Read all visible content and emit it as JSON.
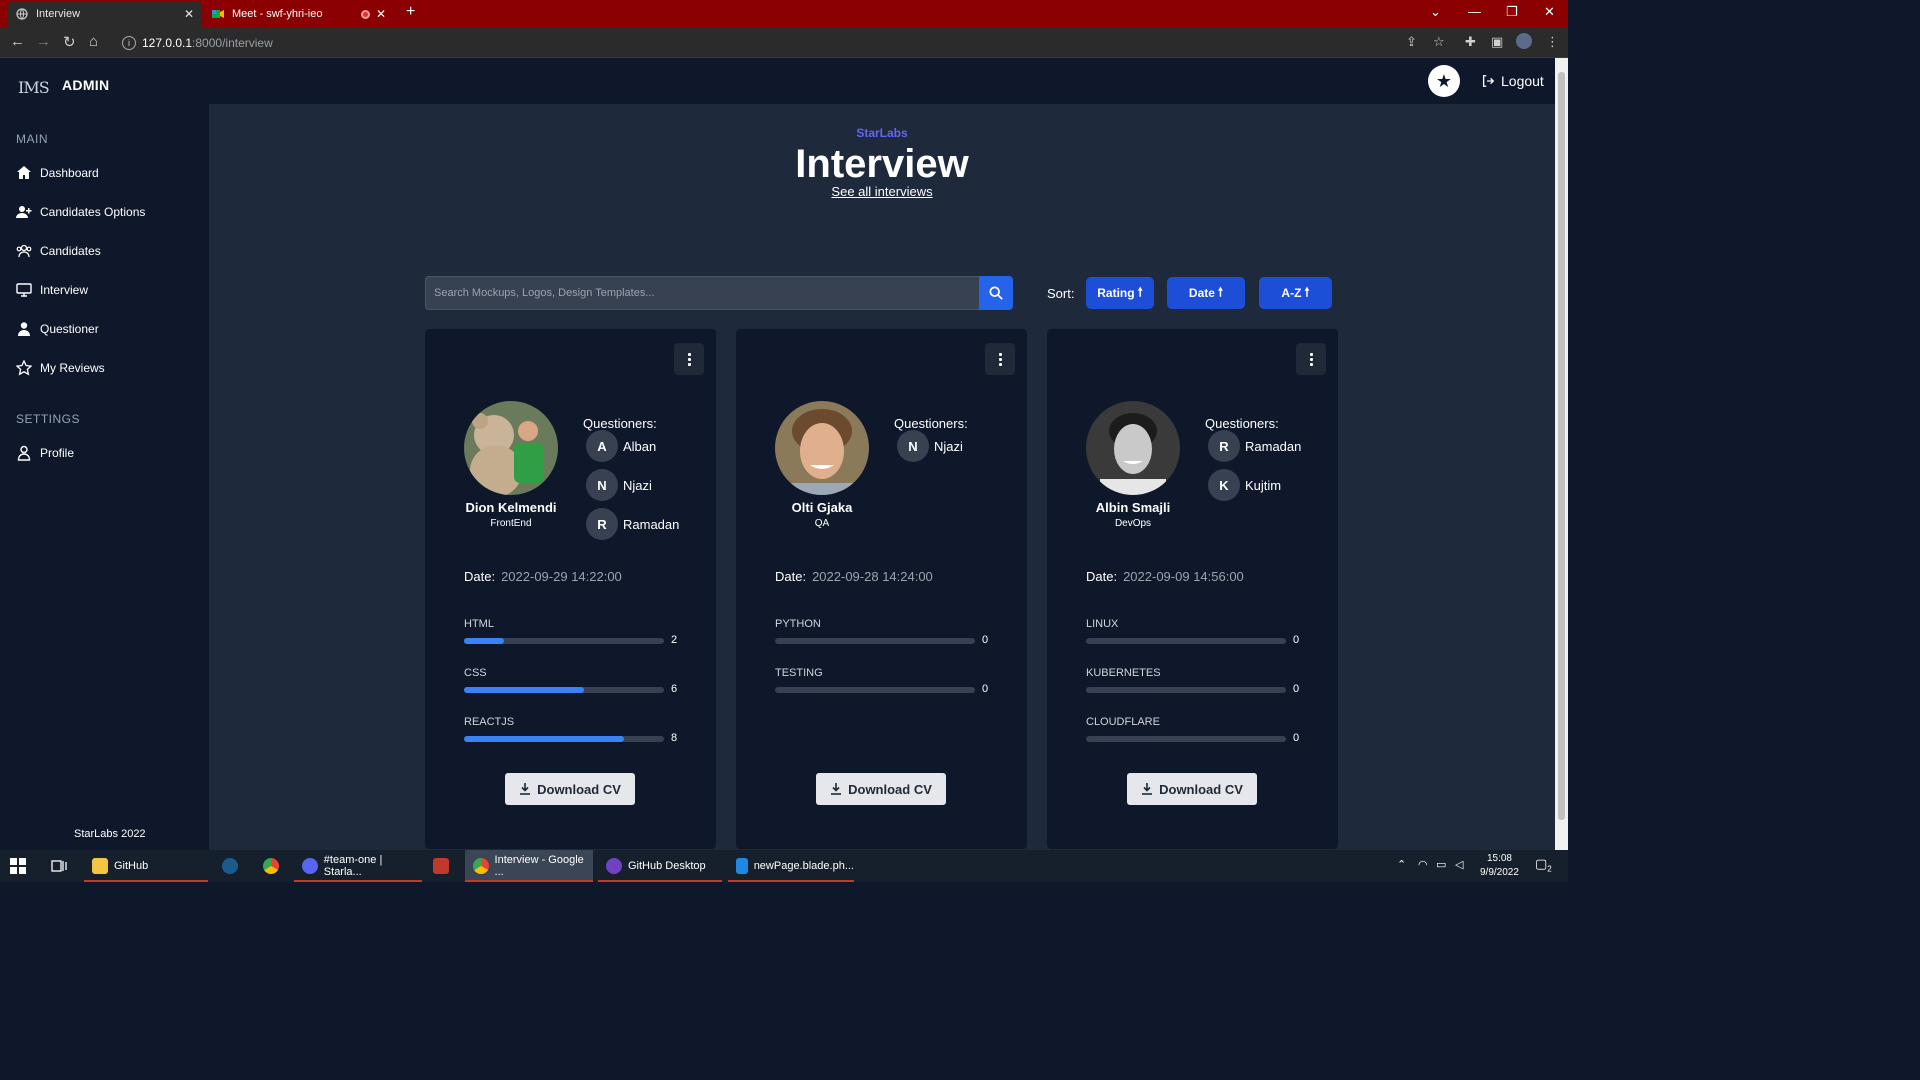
{
  "browser": {
    "tabs": [
      {
        "title": "Interview",
        "active": true
      },
      {
        "title": "Meet - swf-yhri-ieo",
        "active": false,
        "recording": true
      }
    ],
    "url_host": "127.0.0.1",
    "url_path": ":8000/interview"
  },
  "app": {
    "logo": "IMS",
    "role": "ADMIN",
    "logout_label": "Logout"
  },
  "sidebar": {
    "main_section": "MAIN",
    "settings_section": "SETTINGS",
    "items": [
      {
        "label": "Dashboard",
        "icon": "home-icon"
      },
      {
        "label": "Candidates Options",
        "icon": "user-plus-icon"
      },
      {
        "label": "Candidates",
        "icon": "users-icon"
      },
      {
        "label": "Interview",
        "icon": "monitor-icon"
      },
      {
        "label": "Questioner",
        "icon": "user-icon"
      },
      {
        "label": "My Reviews",
        "icon": "star-icon"
      }
    ],
    "settings_items": [
      {
        "label": "Profile",
        "icon": "user-outline-icon"
      }
    ],
    "footer": "StarLabs 2022"
  },
  "page": {
    "brand": "StarLabs",
    "title": "Interview",
    "see_all": "See all interviews"
  },
  "toolbar": {
    "search_placeholder": "Search Mockups, Logos, Design Templates...",
    "sort_label": "Sort:",
    "sort_buttons": [
      "Rating",
      "Date",
      "A-Z"
    ]
  },
  "candidates": [
    {
      "name": "Dion Kelmendi",
      "role": "FrontEnd",
      "questioners_label": "Questioners:",
      "questioners": [
        {
          "initial": "A",
          "name": "Alban"
        },
        {
          "initial": "N",
          "name": "Njazi"
        },
        {
          "initial": "R",
          "name": "Ramadan"
        }
      ],
      "date_label": "Date:",
      "date": "2022-09-29 14:22:00",
      "skills": [
        {
          "name": "HTML",
          "value": 2
        },
        {
          "name": "CSS",
          "value": 6
        },
        {
          "name": "REACTJS",
          "value": 8
        }
      ],
      "download_label": "Download CV"
    },
    {
      "name": "Olti Gjaka",
      "role": "QA",
      "questioners_label": "Questioners:",
      "questioners": [
        {
          "initial": "N",
          "name": "Njazi"
        }
      ],
      "date_label": "Date:",
      "date": "2022-09-28 14:24:00",
      "skills": [
        {
          "name": "PYTHON",
          "value": 0
        },
        {
          "name": "TESTING",
          "value": 0
        }
      ],
      "download_label": "Download CV"
    },
    {
      "name": "Albin Smajli",
      "role": "DevOps",
      "questioners_label": "Questioners:",
      "questioners": [
        {
          "initial": "R",
          "name": "Ramadan"
        },
        {
          "initial": "K",
          "name": "Kujtim"
        }
      ],
      "date_label": "Date:",
      "date": "2022-09-09 14:56:00",
      "skills": [
        {
          "name": "LINUX",
          "value": 0
        },
        {
          "name": "KUBERNETES",
          "value": 0
        },
        {
          "name": "CLOUDFLARE",
          "value": 0
        }
      ],
      "download_label": "Download CV"
    }
  ],
  "skill_max": 10,
  "taskbar": {
    "items": [
      "GitHub",
      "#team-one | Starla...",
      "Interview - Google ...",
      "GitHub Desktop",
      "newPage.blade.ph..."
    ],
    "time": "15:08",
    "date": "9/9/2022",
    "notifications": "2"
  },
  "colors": {
    "accent": "#2563eb",
    "brand": "#6366f1",
    "sidebar_bg": "#0f172a",
    "main_bg": "#1e293b",
    "browser_frame": "#8b0000"
  }
}
